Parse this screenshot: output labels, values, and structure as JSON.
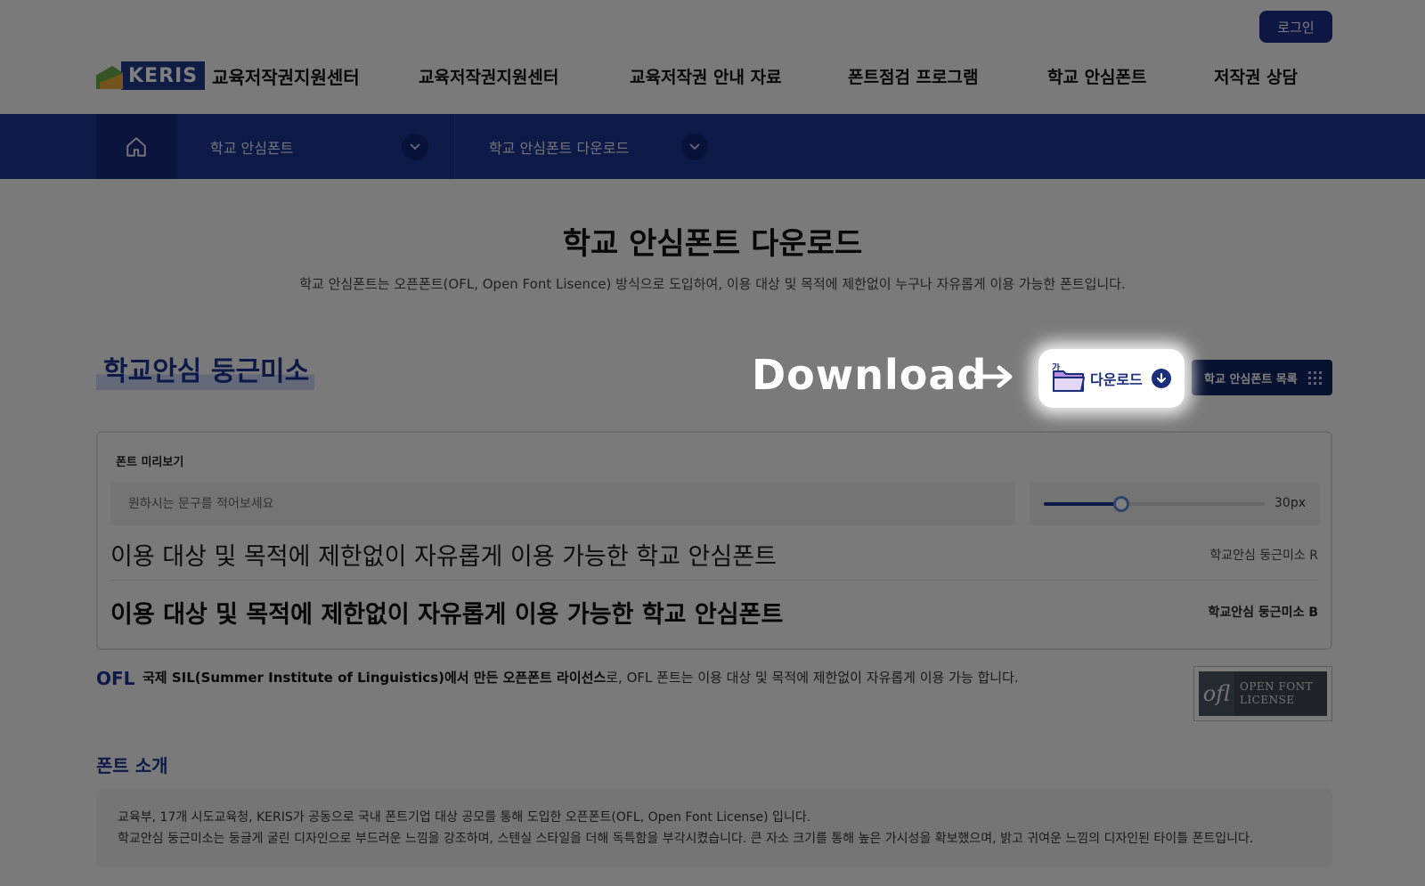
{
  "header": {
    "login_label": "로그인",
    "logo_box": "KERIS",
    "logo_text": "교육저작권지원센터",
    "nav": [
      "교육저작권지원센터",
      "교육저작권 안내 자료",
      "폰트점검 프로그램",
      "학교 안심폰트",
      "저작권 상담"
    ]
  },
  "subnav": {
    "items": [
      "학교 안심폰트",
      "학교 안심폰트 다운로드"
    ]
  },
  "page": {
    "title": "학교 안심폰트 다운로드",
    "description": "학교 안심폰트는 오픈폰트(OFL, Open Font Lisence) 방식으로 도입하여, 이용 대상 및 목적에 제한없이 누구나 자유롭게 이용 가능한 폰트입니다."
  },
  "font": {
    "name": "학교안심 둥근미소",
    "annotation": "Download",
    "download_label": "다운로드",
    "folder_glyph": "가",
    "list_button_label": "학교 안심폰트 목록"
  },
  "preview": {
    "label": "폰트 미리보기",
    "input_placeholder": "원하시는 문구를 적어보세요",
    "size_value": "30px",
    "size_fraction": 0.35,
    "samples": [
      {
        "text": "이용 대상 및 목적에 제한없이 자유롭게 이용 가능한 학교 안심폰트",
        "tag": "학교안심 둥근미소 R"
      },
      {
        "text": "이용 대상 및 목적에 제한없이 자유롭게 이용 가능한 학교 안심폰트",
        "tag": "학교안심 둥근미소 B"
      }
    ]
  },
  "ofl": {
    "badge": "OFL",
    "desc_bold": "국제 SIL(Summer Institute of Linguistics)에서 만든 오픈폰트 라이선스",
    "desc_rest": "로, OFL 폰트는 이용 대상 및 목적에 제한없이 자유롭게 이용 가능 합니다.",
    "logo_mark": "ofl",
    "logo_line1": "OPEN FONT",
    "logo_line2": "LICENSE"
  },
  "intro": {
    "title": "폰트 소개",
    "lines": [
      "교육부, 17개 시도교육청, KERIS가 공동으로 국내 폰트기업 대상 공모를 통해 도입한 오픈폰트(OFL, Open Font License) 입니다.",
      "학교안심 둥근미소는 둥글게 굴린 디자인으로 부드러운 느낌을 강조하며, 스텐실 스타일을 더해 독특함을 부각시켰습니다. 큰 자소 크기를 통해 높은 가시성을 확보했으며, 밝고 귀여운 느낌의 디자인된 타이틀 폰트입니다."
    ]
  },
  "colors": {
    "brand_navy": "#1b3591",
    "overlay": "rgba(0,0,0,0.5)"
  }
}
